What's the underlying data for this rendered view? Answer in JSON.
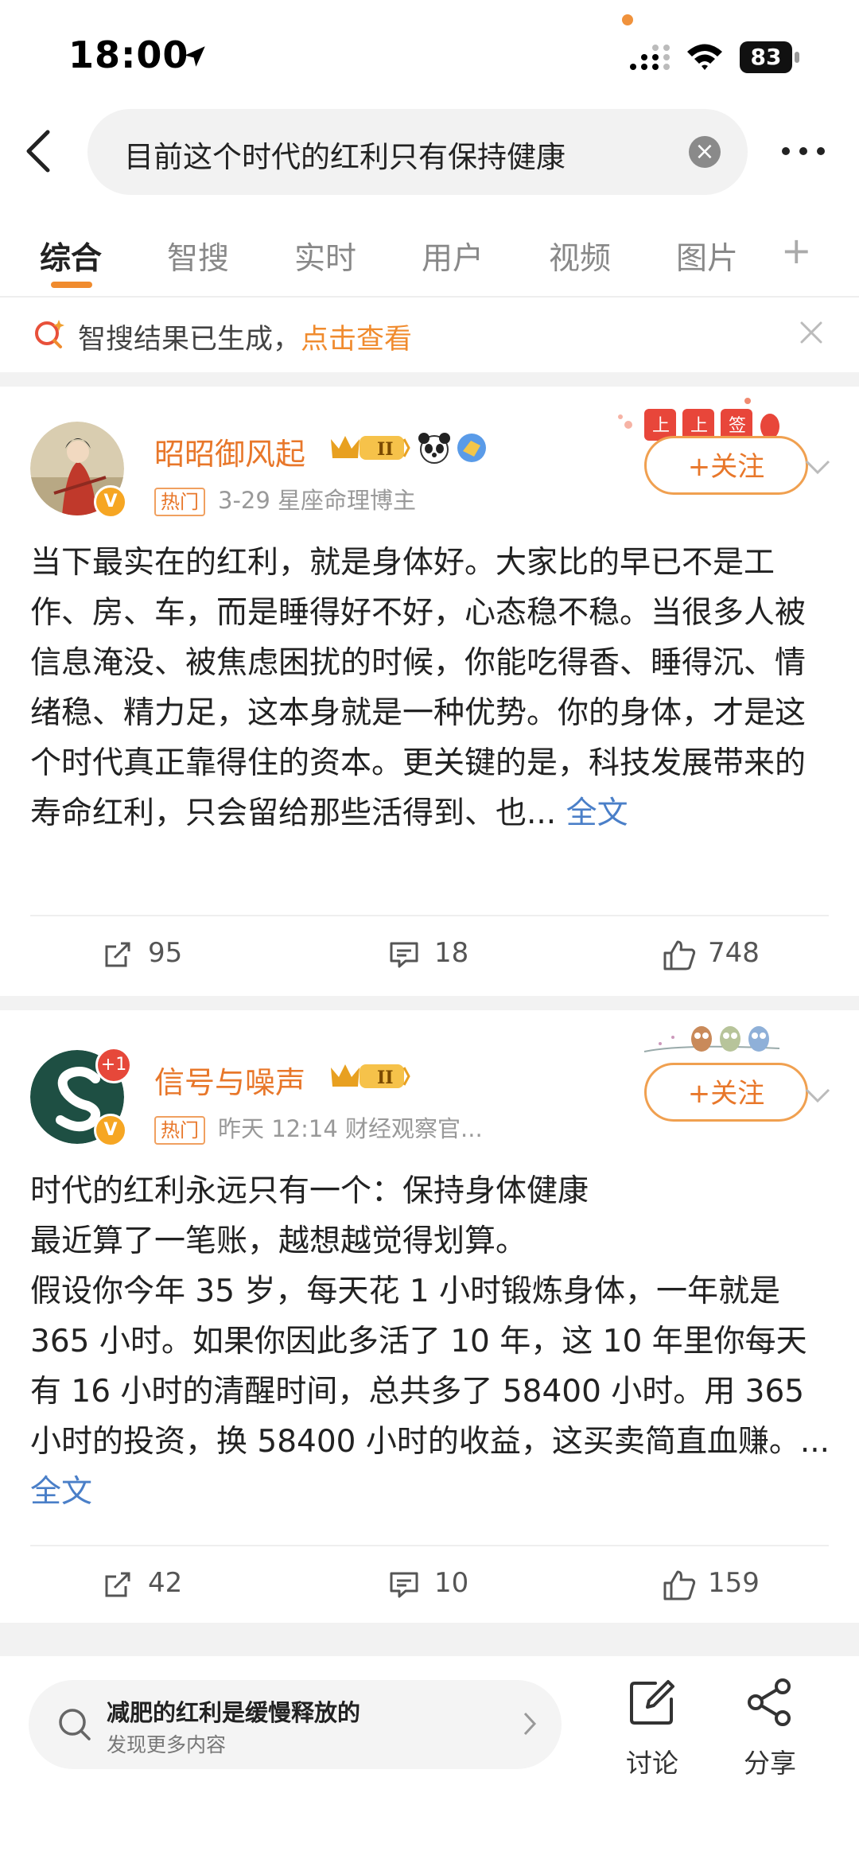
{
  "status": {
    "time": "18:00",
    "battery": "83"
  },
  "search": {
    "query": "目前这个时代的红利只有保持健康"
  },
  "tabs": [
    {
      "label": "综合",
      "active": true
    },
    {
      "label": "智搜"
    },
    {
      "label": "实时"
    },
    {
      "label": "用户"
    },
    {
      "label": "视频"
    },
    {
      "label": "图片"
    }
  ],
  "tabs_more": "+",
  "banner": {
    "text": "智搜结果已生成，",
    "link": "点击查看"
  },
  "posts": [
    {
      "username": "昭昭御风起",
      "tag": "热门",
      "meta": "3-29  星座命理博主",
      "follow": "+关注",
      "body": "当下最实在的红利，就是身体好。大家比的早已不是工作、房、车，而是睡得好不好，心态稳不稳。当很多人被信息淹没、被焦虑困扰的时候，你能吃得香、睡得沉、情绪稳、精力足，这本身就是一种优势。你的身体，才是这个时代真正靠得住的资本。更关键的是，科技发展带来的寿命红利，只会留给那些活得到、也...",
      "read_more": "全文",
      "reposts": "95",
      "comments": "18",
      "likes": "748"
    },
    {
      "username": "信号与噪声",
      "tag": "热门",
      "meta": "昨天 12:14  财经观察官...",
      "follow": "+关注",
      "badge_count": "+1",
      "body_lines": [
        "时代的红利永远只有一个：保持身体健康",
        "最近算了一笔账，越想越觉得划算。",
        "假设你今年 35 岁，每天花 1 小时锻炼身体，一年就是 365 小时。如果你因此多活了 10 年，这 10 年里你每天有 16 小时的清醒时间，总共多了 58400 小时。用 365 小时的投资，换 58400 小时的收益，这买卖简直血赚。..."
      ],
      "read_more": "全文",
      "reposts": "42",
      "comments": "10",
      "likes": "159"
    }
  ],
  "bottom": {
    "search_title": "减肥的红利是缓慢释放的",
    "search_sub": "发现更多内容",
    "discuss": "讨论",
    "share": "分享"
  }
}
